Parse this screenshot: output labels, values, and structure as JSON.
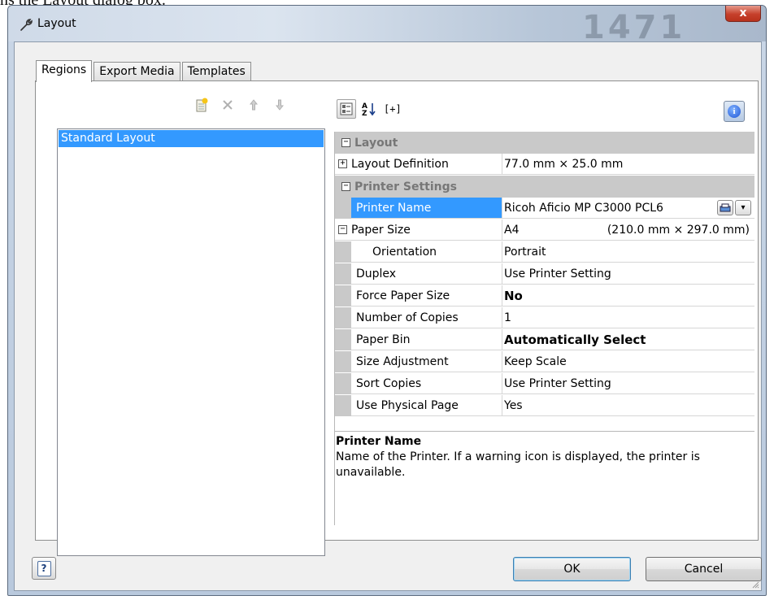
{
  "backdrop_caption": "ns the Layout dialog box.",
  "window": {
    "title": "Layout",
    "watermark": "1471",
    "close_label": "x"
  },
  "tabs": [
    {
      "label": "Regions",
      "active": true
    },
    {
      "label": "Export Media",
      "active": false
    },
    {
      "label": "Templates",
      "active": false
    }
  ],
  "left_toolbar": {
    "icons": [
      "new-region-icon",
      "delete-icon",
      "move-up-icon",
      "move-down-icon"
    ]
  },
  "regions_list": {
    "items": [
      "Standard Layout"
    ],
    "selected_index": 0
  },
  "property_toolbar": {
    "categorized_icon": "categorized-view-icon",
    "sort_label": "A Z",
    "expand_label": "[+]",
    "info_icon": "info-icon"
  },
  "property_grid": {
    "layout_category": "Layout",
    "layout_definition": {
      "name": "Layout Definition",
      "value": "77.0 mm × 25.0 mm"
    },
    "printer_category": "Printer Settings",
    "printer_name": {
      "name": "Printer Name",
      "value": "Ricoh Aficio MP C3000 PCL6"
    },
    "paper_size": {
      "name": "Paper Size",
      "value": "A4",
      "detail": "(210.0 mm × 297.0 mm)"
    },
    "orientation": {
      "name": "Orientation",
      "value": "Portrait"
    },
    "duplex": {
      "name": "Duplex",
      "value": "Use Printer Setting"
    },
    "force_paper_size": {
      "name": "Force Paper Size",
      "value": "No"
    },
    "number_of_copies": {
      "name": "Number of Copies",
      "value": "1"
    },
    "paper_bin": {
      "name": "Paper Bin",
      "value": "Automatically Select"
    },
    "size_adjustment": {
      "name": "Size Adjustment",
      "value": "Keep Scale"
    },
    "sort_copies": {
      "name": "Sort Copies",
      "value": "Use Printer Setting"
    },
    "use_physical_page": {
      "name": "Use Physical Page",
      "value": "Yes"
    }
  },
  "description": {
    "title": "Printer Name",
    "text": "Name of the Printer. If a warning icon is displayed, the printer is unavailable."
  },
  "buttons": {
    "help_label": "?",
    "ok_label": "OK",
    "cancel_label": "Cancel"
  },
  "colors": {
    "selection": "#3399ff",
    "category_band": "#c9c9c9",
    "close_button": "#c6402b"
  }
}
